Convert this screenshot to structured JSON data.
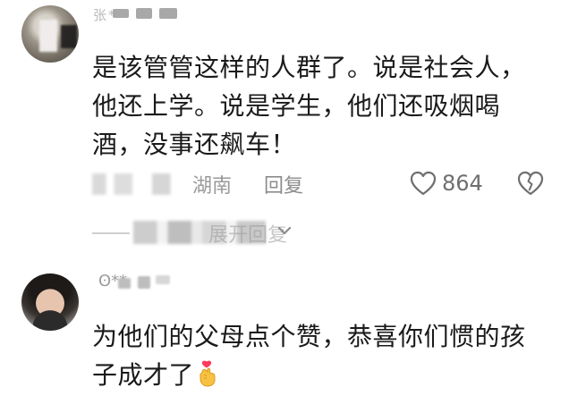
{
  "comments": [
    {
      "username": "张**",
      "text": "是该管管这样的人群了。说是社会人，他还上学。说是学生，他们还吸烟喝酒，没事还飙车！",
      "location": "湖南",
      "reply_label": "回复",
      "like_count": "864",
      "expand_label": "展开回复"
    },
    {
      "username": "ʘ**",
      "text": "为他们的父母点个赞，恭喜你们惯的孩子成才了"
    }
  ],
  "icons": {
    "like": "heart-outline-icon",
    "dislike": "broken-heart-icon",
    "expand": "chevron-down-icon",
    "emoji": "finger-heart-emoji"
  },
  "colors": {
    "text": "#1a1a1a",
    "meta": "#8c8c8c",
    "heart_stroke": "#6f6f6f",
    "emoji_heart": "#ff3b5c",
    "emoji_hand": "#f7c242"
  }
}
